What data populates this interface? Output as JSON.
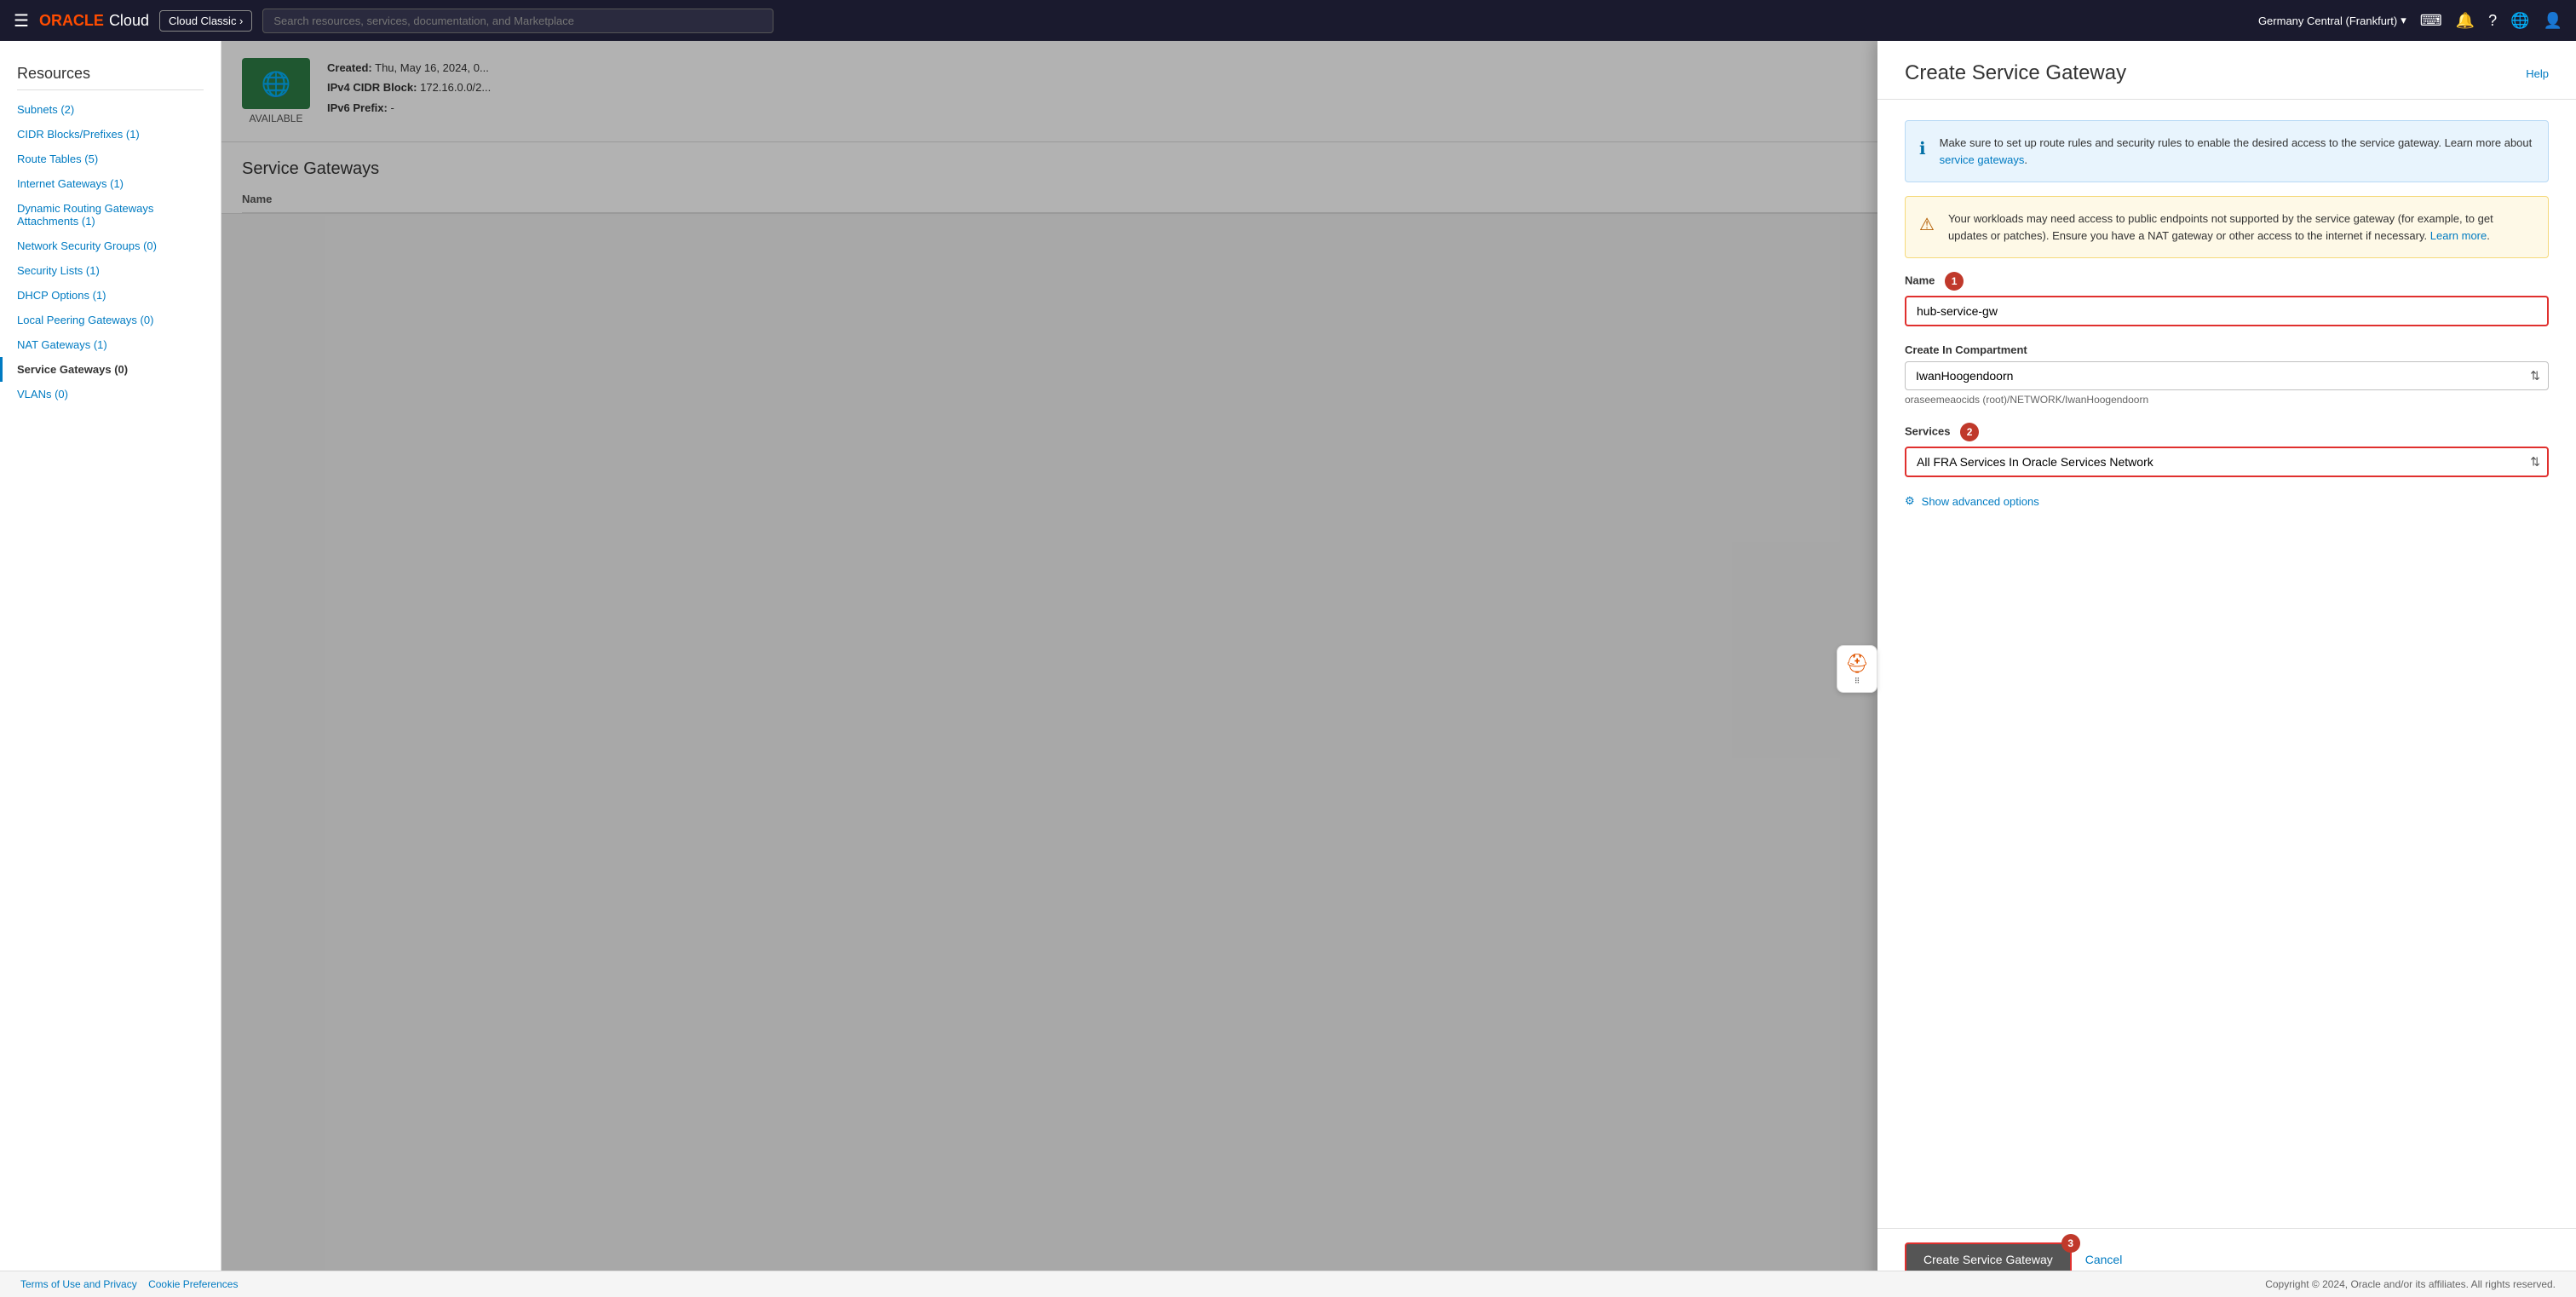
{
  "topnav": {
    "logo_oracle": "ORACLE",
    "logo_cloud": "Cloud",
    "cloud_classic_label": "Cloud Classic ›",
    "search_placeholder": "Search resources, services, documentation, and Marketplace",
    "region": "Germany Central (Frankfurt)",
    "help_icon": "?",
    "globe_icon": "🌐"
  },
  "sidebar": {
    "resources_title": "Resources",
    "items": [
      {
        "label": "Subnets (2)",
        "id": "subnets",
        "active": false
      },
      {
        "label": "CIDR Blocks/Prefixes (1)",
        "id": "cidr-blocks",
        "active": false
      },
      {
        "label": "Route Tables (5)",
        "id": "route-tables",
        "active": false
      },
      {
        "label": "Internet Gateways (1)",
        "id": "internet-gateways",
        "active": false
      },
      {
        "label": "Dynamic Routing Gateways Attachments (1)",
        "id": "drg-attachments",
        "active": false
      },
      {
        "label": "Network Security Groups (0)",
        "id": "nsg",
        "active": false
      },
      {
        "label": "Security Lists (1)",
        "id": "security-lists",
        "active": false
      },
      {
        "label": "DHCP Options (1)",
        "id": "dhcp-options",
        "active": false
      },
      {
        "label": "Local Peering Gateways (0)",
        "id": "local-peering",
        "active": false
      },
      {
        "label": "NAT Gateways (1)",
        "id": "nat-gateways",
        "active": false
      },
      {
        "label": "Service Gateways (0)",
        "id": "service-gateways",
        "active": true
      },
      {
        "label": "VLANs (0)",
        "id": "vlans",
        "active": false
      }
    ]
  },
  "vcn_info": {
    "status": "AVAILABLE",
    "created_label": "Created:",
    "created_value": "Thu, May 16, 2024, 0...",
    "ipv4_label": "IPv4 CIDR Block:",
    "ipv4_value": "172.16.0.0/2...",
    "ipv6_label": "IPv6 Prefix:",
    "ipv6_value": "-"
  },
  "service_gateways": {
    "title": "Service Gateways",
    "create_button": "Create Service Gateway",
    "table_col_name": "Name"
  },
  "modal": {
    "title": "Create Service Gateway",
    "help_label": "Help",
    "info_blue": "Make sure to set up route rules and security rules to enable the desired access to the service gateway. Learn more about service gateways.",
    "info_blue_link": "service gateways",
    "info_amber": "Your workloads may need access to public endpoints not supported by the service gateway (for example, to get updates or patches). Ensure you have a NAT gateway or other access to the internet if necessary.",
    "info_amber_link": "Learn more",
    "name_label": "Name",
    "name_step": "1",
    "name_value": "hub-service-gw",
    "name_placeholder": "",
    "compartment_label": "Create In Compartment",
    "compartment_value": "IwanHoogendoorn",
    "compartment_hint": "oraseemeaocids (root)/NETWORK/IwanHoogendoorn",
    "services_label": "Services",
    "services_step": "2",
    "services_value": "All FRA Services In Oracle Services Network",
    "advanced_options": "Show advanced options",
    "create_button": "Create Service Gateway",
    "create_step": "3",
    "cancel_label": "Cancel"
  },
  "footer": {
    "terms": "Terms of Use and Privacy",
    "cookies": "Cookie Preferences",
    "copyright": "Copyright © 2024, Oracle and/or its affiliates. All rights reserved."
  }
}
